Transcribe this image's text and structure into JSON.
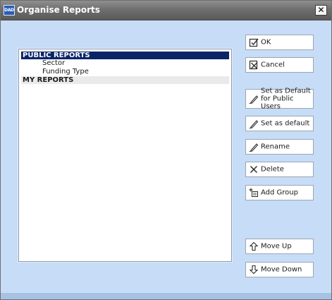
{
  "window": {
    "title": "Organise Reports",
    "logo_text": "DAD",
    "close_glyph": "✕"
  },
  "list": {
    "groups": [
      {
        "label": "PUBLIC REPORTS",
        "selected": true,
        "items": [
          "Sector",
          "Funding Type"
        ]
      },
      {
        "label": "MY REPORTS",
        "selected": false,
        "items": []
      }
    ]
  },
  "buttons": {
    "ok": {
      "label": "OK",
      "icon": "check-icon"
    },
    "cancel": {
      "label": "Cancel",
      "icon": "cancel-icon"
    },
    "set_default_public": {
      "label": "Set as Default for Public Users",
      "icon": "pencil-icon"
    },
    "set_default": {
      "label": "Set as default",
      "icon": "pencil-icon"
    },
    "rename": {
      "label": "Rename",
      "icon": "pencil-icon"
    },
    "delete": {
      "label": "Delete",
      "icon": "delete-icon"
    },
    "add_group": {
      "label": "Add Group",
      "icon": "add-group-icon"
    },
    "move_up": {
      "label": "Move Up",
      "icon": "arrow-up-icon"
    },
    "move_down": {
      "label": "Move Down",
      "icon": "arrow-down-icon"
    }
  }
}
